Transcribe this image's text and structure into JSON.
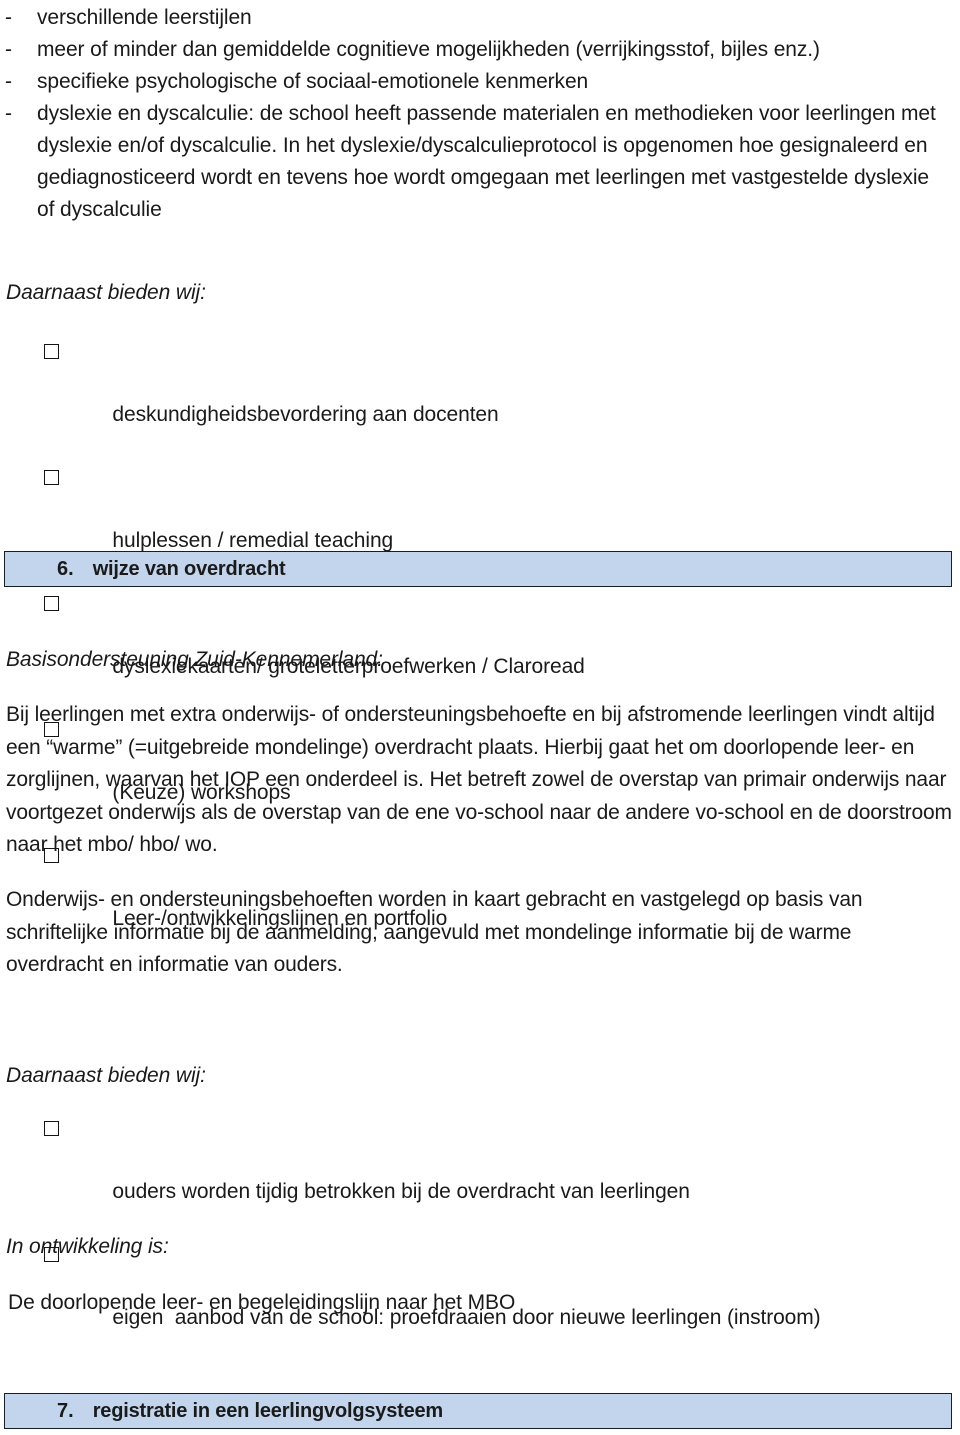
{
  "intro_list": {
    "marker": "-",
    "items": [
      "verschillende leerstijlen",
      "meer of minder dan gemiddelde cognitieve mogelijkheden (verrijkingsstof, bijles enz.)",
      "specifieke psychologische of sociaal-emotionele kenmerken",
      "dyslexie en dyscalculie: de school heeft passende materialen en methodieken voor leerlingen met dyslexie en/of dyscalculie. In het dyslexie/dyscalculieprotocol is opgenomen hoe gesignaleerd en gediagnosticeerd wordt en tevens hoe wordt omgegaan met leerlingen met vastgestelde dyslexie of dyscalculie"
    ]
  },
  "offer_heading_1": "Daarnaast bieden wij:",
  "offer_list_1": [
    "deskundigheidsbevordering aan docenten",
    "hulplessen / remedial teaching",
    "dyslexiekaarten/ groteletterproefwerken / Claroread",
    "(Keuze) workshops",
    "Leer-/ontwikkelingslijnen en portfolio"
  ],
  "section_6": {
    "number": "6.",
    "title": "wijze van overdracht",
    "fill_color": "#c2d5ec",
    "border_color": "#15202b"
  },
  "basis_heading": "Basisondersteuning Zuid-Kennemerland:",
  "paragraph_1": "Bij leerlingen met extra onderwijs- of ondersteuningsbehoefte en bij afstromende leerlingen vindt altijd een “warme” (=uitgebreide mondelinge) overdracht plaats. Hierbij gaat het om doorlopende leer- en zorglijnen, waarvan het IOP een onderdeel is. Het betreft zowel de overstap van primair onderwijs naar voortgezet onderwijs als de overstap van de ene vo-school naar de andere vo-school en de doorstroom naar het mbo/ hbo/ wo.",
  "paragraph_2": "Onderwijs- en ondersteuningsbehoeften worden in kaart gebracht en vastgelegd op basis van schriftelijke informatie bij de aanmelding, aangevuld met mondelinge informatie bij de warme overdracht en informatie van ouders.",
  "offer_heading_2": "Daarnaast bieden wij:",
  "offer_list_2": [
    "ouders worden tijdig betrokken bij de overdracht van leerlingen",
    "eigen  aanbod van de school: proefdraaien door nieuwe leerlingen (instroom)"
  ],
  "development_heading": "In ontwikkeling is:",
  "development_text": "De doorlopende leer- en begeleidingslijn naar het MBO",
  "section_7": {
    "number": "7.",
    "title": "registratie in een leerlingvolgsysteem",
    "fill_color": "#c2d5ec",
    "border_color": "#15202b"
  }
}
